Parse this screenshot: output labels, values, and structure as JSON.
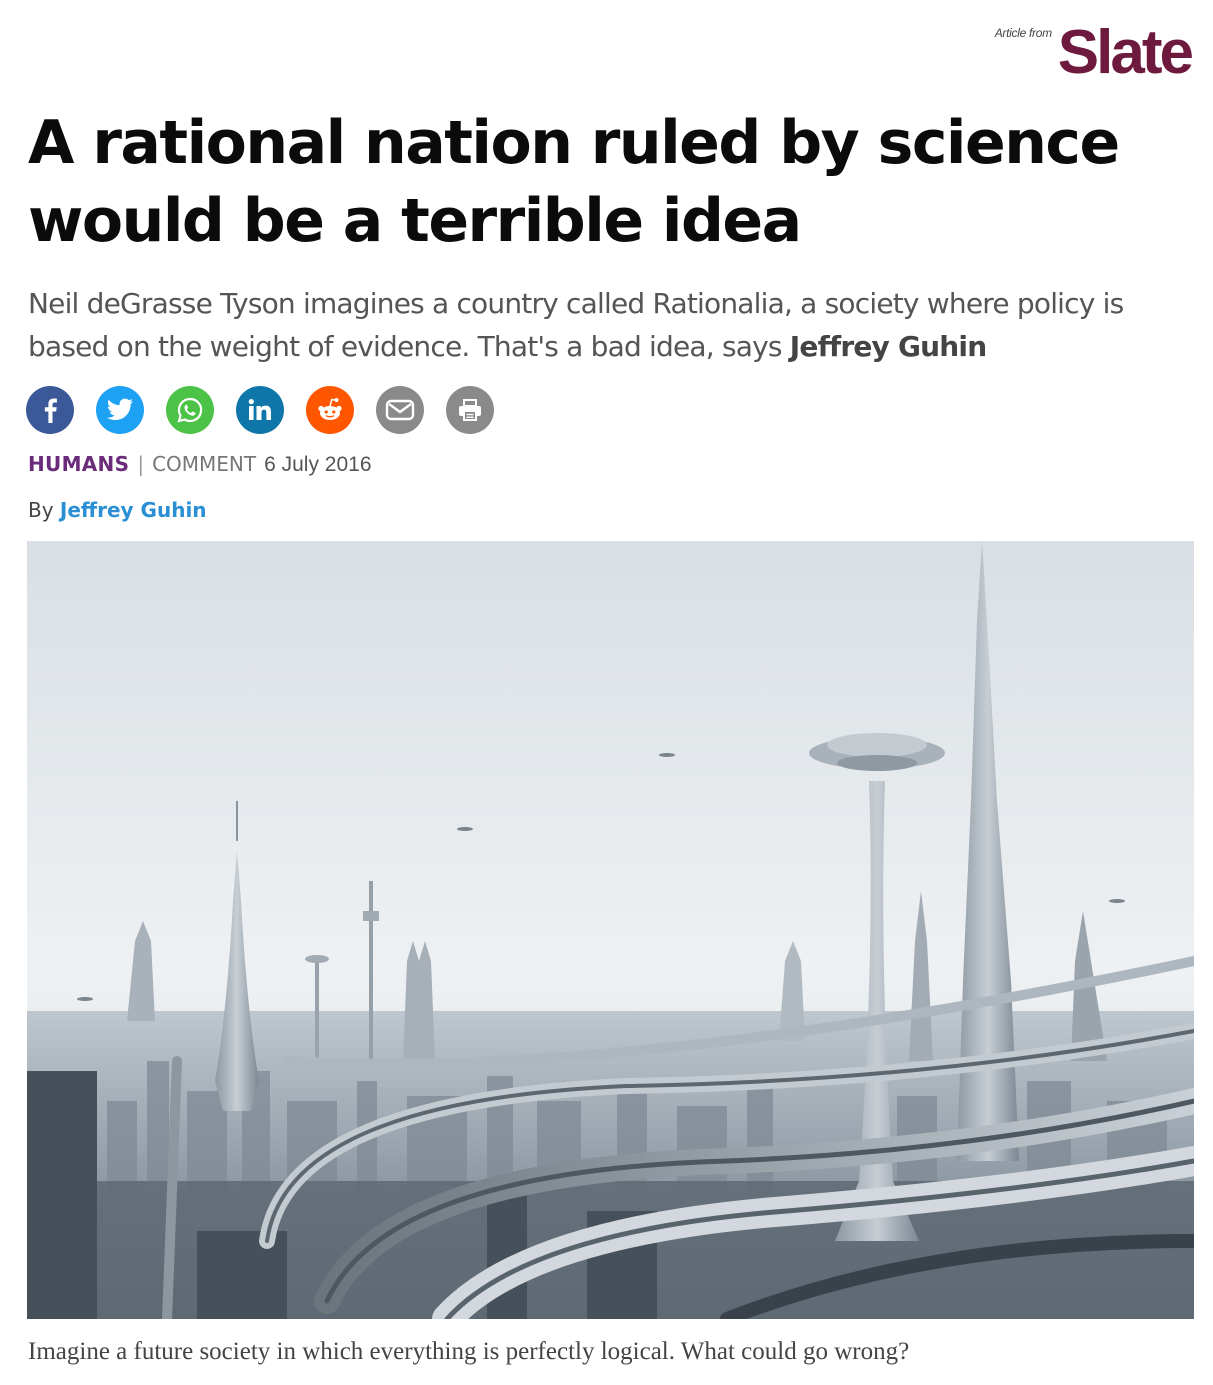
{
  "attribution": {
    "prefix": "Article from",
    "publication": "Slate"
  },
  "article": {
    "headline": "A rational nation ruled by science would be a terrible idea",
    "standfirst_text": "Neil deGrasse Tyson imagines a country called Rationalia, a society where policy is based on the weight of evidence. That's a bad idea, says ",
    "standfirst_author": "Jeffrey Guhin",
    "section": "HUMANS",
    "separator": "|",
    "comment_label": "COMMENT",
    "date": "6 July 2016",
    "byline_prefix": "By",
    "author": "Jeffrey Guhin",
    "caption": "Imagine a future society in which everything is perfectly logical. What could go wrong?"
  },
  "share": [
    {
      "name": "facebook-icon",
      "color": "#3b5998"
    },
    {
      "name": "twitter-icon",
      "color": "#1da1f2"
    },
    {
      "name": "whatsapp-icon",
      "color": "#4cc246"
    },
    {
      "name": "linkedin-icon",
      "color": "#0e76a8"
    },
    {
      "name": "reddit-icon",
      "color": "#ff5700"
    },
    {
      "name": "email-icon",
      "color": "#8a8a8a"
    },
    {
      "name": "print-icon",
      "color": "#8a8a8a"
    }
  ],
  "colors": {
    "slate_brand": "#6e1a3e",
    "section": "#6a2c7a",
    "author_link": "#2b8fd4"
  }
}
